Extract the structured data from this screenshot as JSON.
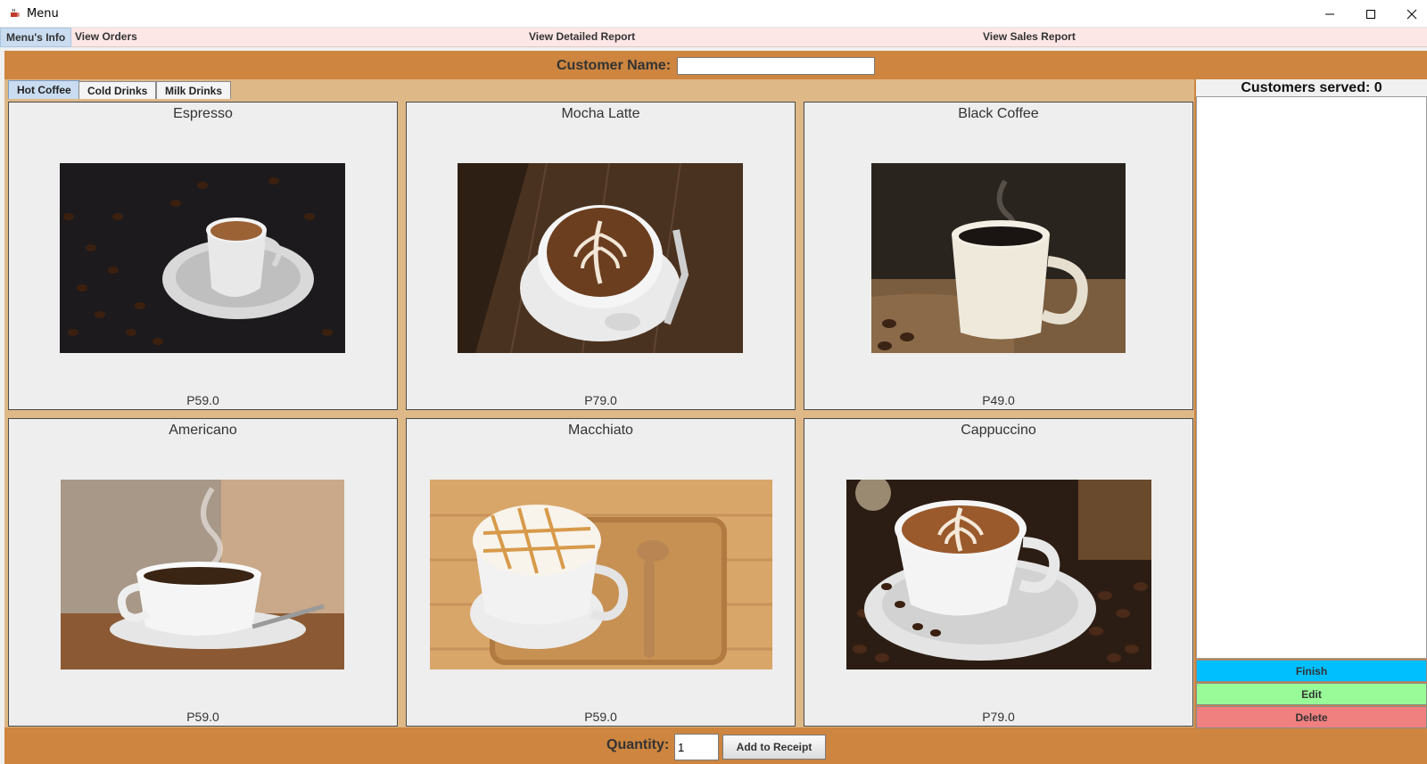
{
  "window": {
    "title": "Menu"
  },
  "menubar": {
    "items": [
      {
        "label": "Menu's Info"
      },
      {
        "label": "View Orders"
      },
      {
        "label": "View Detailed Report"
      },
      {
        "label": "View Sales Report"
      }
    ]
  },
  "customer": {
    "label": "Customer Name:",
    "value": ""
  },
  "tabs": [
    {
      "label": "Hot Coffee",
      "active": true
    },
    {
      "label": "Cold Drinks",
      "active": false
    },
    {
      "label": "Milk Drinks",
      "active": false
    }
  ],
  "items": [
    {
      "name": "Espresso",
      "price": "P59.0"
    },
    {
      "name": "Mocha Latte",
      "price": "P79.0"
    },
    {
      "name": "Black Coffee",
      "price": "P49.0"
    },
    {
      "name": "Americano",
      "price": "P59.0"
    },
    {
      "name": "Macchiato",
      "price": "P59.0"
    },
    {
      "name": "Cappuccino",
      "price": "P79.0"
    }
  ],
  "side": {
    "served": "Customers served: 0",
    "finish": "Finish",
    "edit": "Edit",
    "delete": "Delete"
  },
  "bottom": {
    "quantity_label": "Quantity:",
    "quantity_value": "1",
    "add_button": "Add to Receipt"
  },
  "colors": {
    "frame": "#cd853f",
    "grid_bg": "#deb887",
    "menubar": "#fde6e6",
    "finish": "#00bfff",
    "edit": "#98fb98",
    "delete": "#f08080"
  }
}
